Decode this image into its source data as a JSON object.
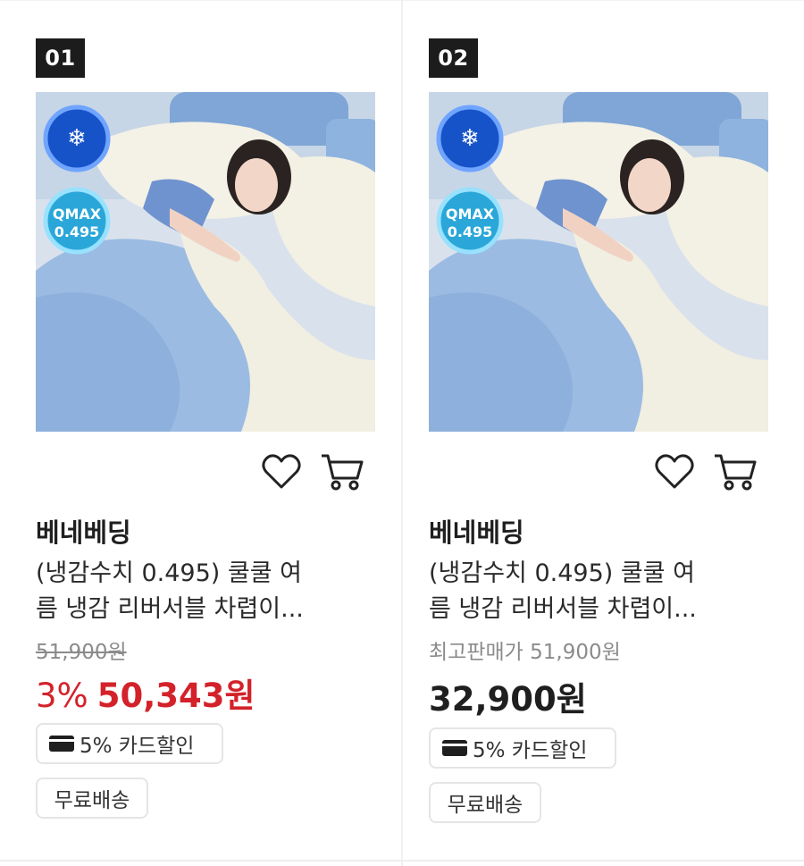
{
  "products": [
    {
      "rank": "01",
      "badges": {
        "cooling_icon": "snowflake-thermometer-icon",
        "qmax_top": "QMAX",
        "qmax_value": "0.495"
      },
      "brand": "베네베딩",
      "title_line1": "(냉감수치 0.495) 쿨쿨 여",
      "title_line2": "름 냉감 리버서블 차렵이...",
      "original_price": "51,900원",
      "discount_rate": "3%",
      "sale_price": "50,343원",
      "card_discount": "5% 카드할인",
      "shipping": "무료배송"
    },
    {
      "rank": "02",
      "badges": {
        "cooling_icon": "snowflake-thermometer-icon",
        "qmax_top": "QMAX",
        "qmax_value": "0.495"
      },
      "brand": "베네베딩",
      "title_line1": "(냉감수치 0.495) 쿨쿨 여",
      "title_line2": "름 냉감 리버서블 차렵이...",
      "best_price_label": "최고판매가 51,900원",
      "sale_price": "32,900원",
      "card_discount": "5% 카드할인",
      "shipping": "무료배송"
    }
  ],
  "colors": {
    "sale_red": "#d3222a",
    "rank_bg": "#1c1c1c",
    "badge_blue": "#1753c8",
    "badge_cyan": "#2aa7d8"
  }
}
